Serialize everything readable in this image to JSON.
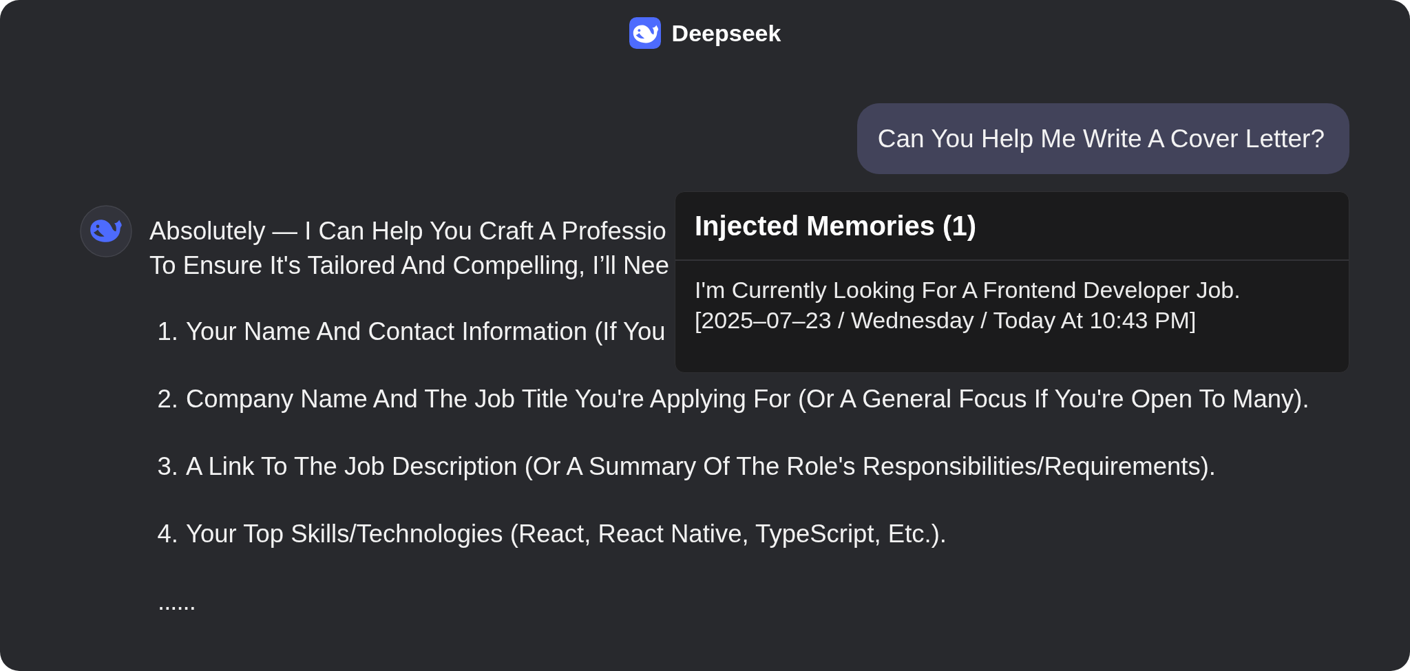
{
  "header": {
    "title": "Deepseek"
  },
  "user_message": {
    "text": "Can You Help Me Write A Cover Letter?"
  },
  "assistant_message": {
    "intro_lines": [
      "Absolutely — I Can Help You Craft A Professio",
      "To Ensure It's Tailored And Compelling, I’ll Nee"
    ],
    "items": [
      {
        "number": "1.",
        "text": "Your Name And Contact Information (If You"
      },
      {
        "number": "2.",
        "text": "Company Name And The Job Title You're Applying For (Or A General Focus If You're Open To Many)."
      },
      {
        "number": "3.",
        "text": "A Link To The Job Description (Or A Summary Of The Role's Responsibilities/Requirements)."
      },
      {
        "number": "4.",
        "text": "Your Top Skills/Technologies (React, React Native, TypeScript, Etc.)."
      }
    ],
    "ellipsis": "......"
  },
  "memory_popup": {
    "title": "Injected Memories (1)",
    "memories": [
      {
        "text": "I'm Currently Looking For A Frontend Developer Job.",
        "timestamp": "[2025–07–23 / Wednesday / Today At 10:43 PM]"
      }
    ]
  }
}
